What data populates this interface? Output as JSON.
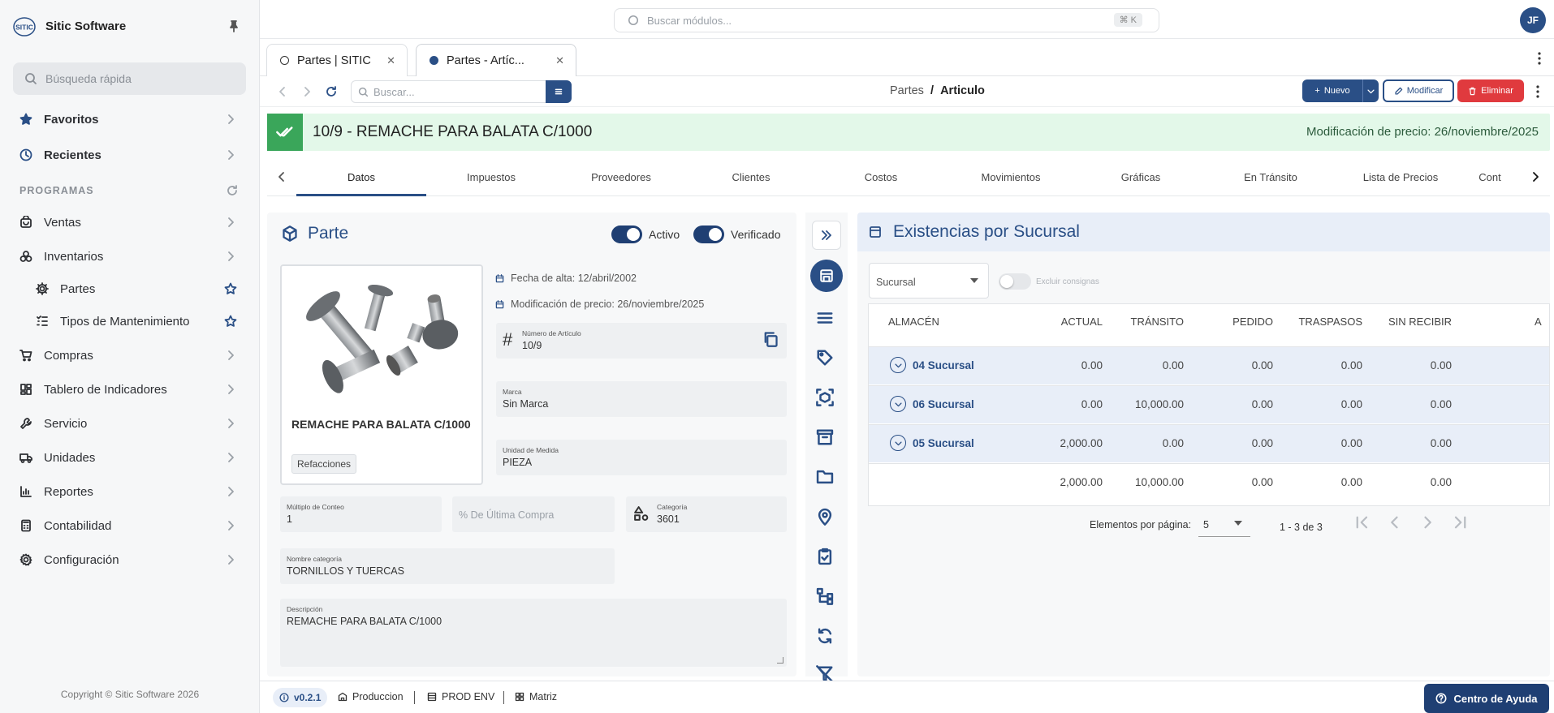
{
  "brand": {
    "name": "Sitic Software",
    "logo_text": "SITIC"
  },
  "sidebar": {
    "search_placeholder": "Búsqueda rápida",
    "favorites": "Favoritos",
    "recents": "Recientes",
    "section_label": "PROGRAMAS",
    "items": [
      {
        "label": "Ventas",
        "icon": "cart-icon"
      },
      {
        "label": "Inventarios",
        "icon": "boxes-icon"
      },
      {
        "label": "Partes",
        "icon": "gear-icon",
        "sub": true
      },
      {
        "label": "Tipos de Mantenimiento",
        "icon": "list-check-icon",
        "sub": true
      },
      {
        "label": "Compras",
        "icon": "shopping-cart-icon"
      },
      {
        "label": "Tablero de Indicadores",
        "icon": "dashboard-icon"
      },
      {
        "label": "Servicio",
        "icon": "wrench-icon"
      },
      {
        "label": "Unidades",
        "icon": "truck-icon"
      },
      {
        "label": "Reportes",
        "icon": "report-icon"
      },
      {
        "label": "Contabilidad",
        "icon": "calculator-icon"
      },
      {
        "label": "Configuración",
        "icon": "settings-icon"
      }
    ],
    "copyright": "Copyright © Sitic Software 2026"
  },
  "topbar": {
    "search_placeholder": "Buscar módulos...",
    "shortcut": "⌘ K",
    "avatar": "JF"
  },
  "tabs": [
    {
      "label": "Partes | SITIC",
      "active": false
    },
    {
      "label": "Partes - Artíc...",
      "active": true
    }
  ],
  "toolbar": {
    "search_placeholder": "Buscar...",
    "breadcrumb_parent": "Partes",
    "breadcrumb_sep": "/",
    "breadcrumb_current": "Articulo",
    "new_label": "Nuevo",
    "modify_label": "Modificar",
    "delete_label": "Eliminar"
  },
  "banner": {
    "title": "10/9 - REMACHE PARA BALATA C/1000",
    "price_update": "Modificación de precio: 26/noviembre/2025",
    "color": "#e3f8e9"
  },
  "subtabs": [
    "Datos",
    "Impuestos",
    "Proveedores",
    "Clientes",
    "Costos",
    "Movimientos",
    "Gráficas",
    "En Tránsito",
    "Lista de Precios",
    "Cont"
  ],
  "part": {
    "title": "Parte",
    "active_label": "Activo",
    "verified_label": "Verificado",
    "name": "REMACHE PARA BALATA C/1000",
    "chip": "Refacciones",
    "fecha_alta": "Fecha de alta: 12/abril/2002",
    "mod_precio": "Modificación de precio: 26/noviembre/2025",
    "fields": {
      "numero_label": "Número de Artículo",
      "numero": "10/9",
      "marca_label": "Marca",
      "marca": "Sin Marca",
      "unidad_label": "Unidad de Medida",
      "unidad": "PIEZA",
      "multiplo_label": "Múltiplo de Conteo",
      "multiplo": "1",
      "ultima_compra_placeholder": "% De Última Compra",
      "categoria_label": "Categoría",
      "categoria": "3601",
      "nombre_cat_label": "Nombre categoría",
      "nombre_cat": "TORNILLOS Y TUERCAS",
      "descripcion_label": "Descripción",
      "descripcion": "REMACHE  PARA BALATA C/1000"
    }
  },
  "stock": {
    "title": "Existencias por Sucursal",
    "branch_select": "Sucursal",
    "exclude_label": "Excluir consignas",
    "columns": [
      "ALMACÉN",
      "ACTUAL",
      "TRÁNSITO",
      "PEDIDO",
      "TRASPASOS",
      "SIN RECIBIR",
      "A"
    ],
    "rows": [
      {
        "name": "04 Sucursal",
        "actual": "0.00",
        "transito": "0.00",
        "pedido": "0.00",
        "traspasos": "0.00",
        "sin_recibir": "0.00"
      },
      {
        "name": "06 Sucursal",
        "actual": "0.00",
        "transito": "10,000.00",
        "pedido": "0.00",
        "traspasos": "0.00",
        "sin_recibir": "0.00"
      },
      {
        "name": "05 Sucursal",
        "actual": "2,000.00",
        "transito": "0.00",
        "pedido": "0.00",
        "traspasos": "0.00",
        "sin_recibir": "0.00"
      }
    ],
    "totals": {
      "actual": "2,000.00",
      "transito": "10,000.00",
      "pedido": "0.00",
      "traspasos": "0.00",
      "sin_recibir": "0.00"
    },
    "per_page_label": "Elementos por página:",
    "per_page": "5",
    "range": "1 - 3 de 3"
  },
  "status": {
    "version": "v0.2.1",
    "env1": "Produccion",
    "env2": "PROD ENV",
    "env3": "Matriz",
    "help": "Centro de Ayuda"
  },
  "colors": {
    "primary": "#2a4f86",
    "danger": "#e03a3e",
    "success": "#3aa65a"
  }
}
